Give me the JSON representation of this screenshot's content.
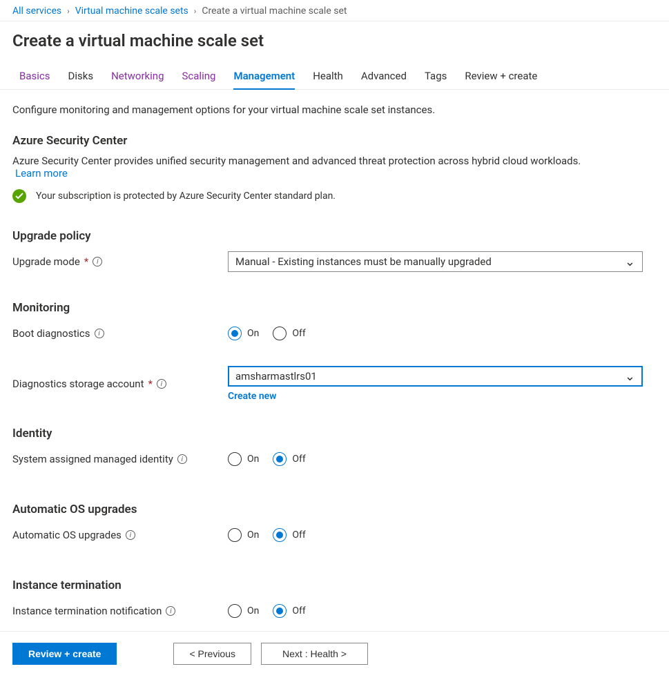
{
  "breadcrumb": {
    "items": [
      {
        "label": "All services",
        "link": true
      },
      {
        "label": "Virtual machine scale sets",
        "link": true
      },
      {
        "label": "Create a virtual machine scale set",
        "link": false
      }
    ]
  },
  "title": "Create a virtual machine scale set",
  "tabs": {
    "basics": "Basics",
    "disks": "Disks",
    "networking": "Networking",
    "scaling": "Scaling",
    "management": "Management",
    "health": "Health",
    "advanced": "Advanced",
    "tags": "Tags",
    "review": "Review + create"
  },
  "description": "Configure monitoring and management options for your virtual machine scale set instances.",
  "security_center": {
    "heading": "Azure Security Center",
    "text": "Azure Security Center provides unified security management and advanced threat protection across hybrid cloud workloads. ",
    "learn_more": "Learn more",
    "status": "Your subscription is protected by Azure Security Center standard plan."
  },
  "upgrade_policy": {
    "heading": "Upgrade policy",
    "mode_label": "Upgrade mode",
    "mode_value": "Manual - Existing instances must be manually upgraded"
  },
  "monitoring": {
    "heading": "Monitoring",
    "boot_label": "Boot diagnostics",
    "boot_value": "On",
    "storage_label": "Diagnostics storage account",
    "storage_value": "amsharmastlrs01",
    "create_new": "Create new"
  },
  "identity": {
    "heading": "Identity",
    "label": "System assigned managed identity",
    "value": "Off"
  },
  "auto_os": {
    "heading": "Automatic OS upgrades",
    "label": "Automatic OS upgrades",
    "value": "Off"
  },
  "termination": {
    "heading": "Instance termination",
    "label": "Instance termination notification",
    "value": "Off"
  },
  "radio": {
    "on": "On",
    "off": "Off"
  },
  "footer": {
    "review": "Review + create",
    "previous": "<  Previous",
    "next": "Next : Health  >"
  }
}
